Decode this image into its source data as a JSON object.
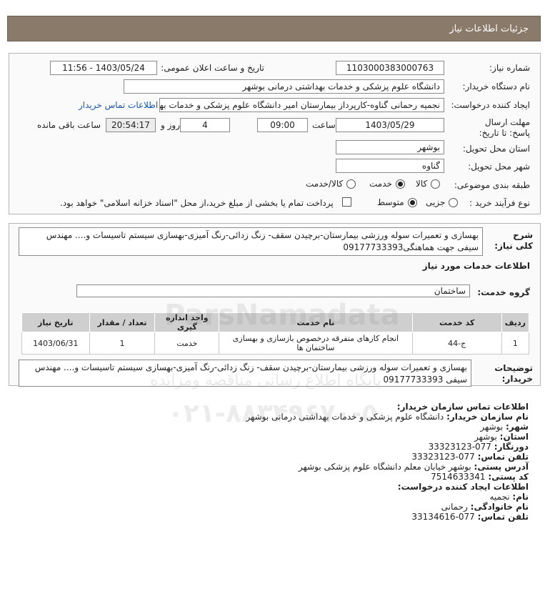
{
  "header": {
    "title": "جزئیات اطلاعات نیاز"
  },
  "form": {
    "need_number_label": "شماره نیاز:",
    "need_number": "1103000383000763",
    "announce_label": "تاریخ و ساعت اعلان عمومی:",
    "announce_value": "1403/05/24 - 11:56",
    "buyer_org_label": "نام دستگاه خریدار:",
    "buyer_org": "دانشگاه علوم پزشکی و خدمات بهداشتی درمانی بوشهر",
    "creator_label": "ایجاد کننده درخواست:",
    "creator": "نجمیه رحمانی گناوه-کارپرداز بیمارستان امیر دانشگاه علوم پزشکی و خدمات بهد",
    "contact_link": "اطلاعات تماس خریدار",
    "deadline_label": "مهلت ارسال پاسخ: تا تاریخ:",
    "deadline_date": "1403/05/29",
    "time_label": "ساعت",
    "deadline_time": "09:00",
    "days_value": "4",
    "days_label": "روز و",
    "remaining_time": "20:54:17",
    "remaining_label": "ساعت باقی مانده",
    "province_label": "استان محل تحویل:",
    "province": "بوشهر",
    "city_label": "شهر محل تحویل:",
    "city": "گناوه",
    "category_label": "طبقه بندی موضوعی:",
    "category_options": [
      "کالا",
      "خدمت",
      "کالا/خدمت"
    ],
    "category_selected": "خدمت",
    "process_label": "نوع فرآیند خرید :",
    "process_options": [
      "جزیی",
      "متوسط"
    ],
    "process_selected": "متوسط",
    "treasury_text": "پرداخت تمام یا بخشی از مبلغ خرید،از محل \"اسناد خزانه اسلامی\" خواهد بود."
  },
  "description": {
    "label": "شرح کلی نیاز:",
    "text": "بهسازی و تعمیرات سوله ورزشی بیمارستان-برچیدن سقف- زنگ زدائی-رنگ آمیزی-بهسازی سیستم تاسیسات و.... مهندس سیفی جهت هماهنگی09177733393"
  },
  "services": {
    "section_title": "اطلاعات خدمات مورد نیاز",
    "group_label": "گروه خدمت:",
    "group_value": "ساختمان",
    "columns": [
      "ردیف",
      "کد خدمت",
      "نام خدمت",
      "واحد اندازه گیری",
      "تعداد / مقدار",
      "تاریخ نیاز"
    ],
    "rows": [
      {
        "row": "1",
        "code": "ج-44",
        "name": "انجام کارهای متفرقه درخصوص بازسازی و بهسازی ساختمان ها",
        "unit": "خدمت",
        "qty": "1",
        "date": "1403/06/31"
      }
    ]
  },
  "buyer_notes": {
    "label": "توضیحات خریدار:",
    "text": "بهسازی و تعمیرات سوله ورزشی بیمارستان-برچیدن سقف- زنگ زدائی-رنگ آمیزی-بهسازی سیستم تاسیسات و.... مهندس سیفی 09177733393"
  },
  "contact": {
    "title": "اطلاعات تماس سازمان خریدار:",
    "org_label": "نام سازمان خریدار:",
    "org": "دانشگاه علوم پزشکی و خدمات بهداشتی درمانی بوشهر",
    "city_label": "شهر:",
    "city": "بوشهر",
    "province_label": "استان:",
    "province": "بوشهر",
    "fax_label": "دورنگار:",
    "fax": "077-33323123",
    "phone_label": "تلفن تماس:",
    "phone": "077-33323123",
    "address_label": "آدرس پستی:",
    "address": "بوشهر خیابان معلم دانشگاه علوم پزشکی بوشهر",
    "postal_label": "کد پستی:",
    "postal": "7514633341",
    "requester_title": "اطلاعات ایجاد کننده درخواست:",
    "name_label": "نام:",
    "name": "نجمیه",
    "family_label": "نام خانوادگی:",
    "family": "رحمانی",
    "req_phone_label": "تلفن تماس:",
    "req_phone": "077-33134616"
  },
  "watermark": {
    "brand": "ParsNamadata",
    "line1": "پایگاه اطلاع رسانی مناقصه ومزایده",
    "phone": "۰۲۱-۸۸۳۴۹۶۷۰-۵"
  }
}
